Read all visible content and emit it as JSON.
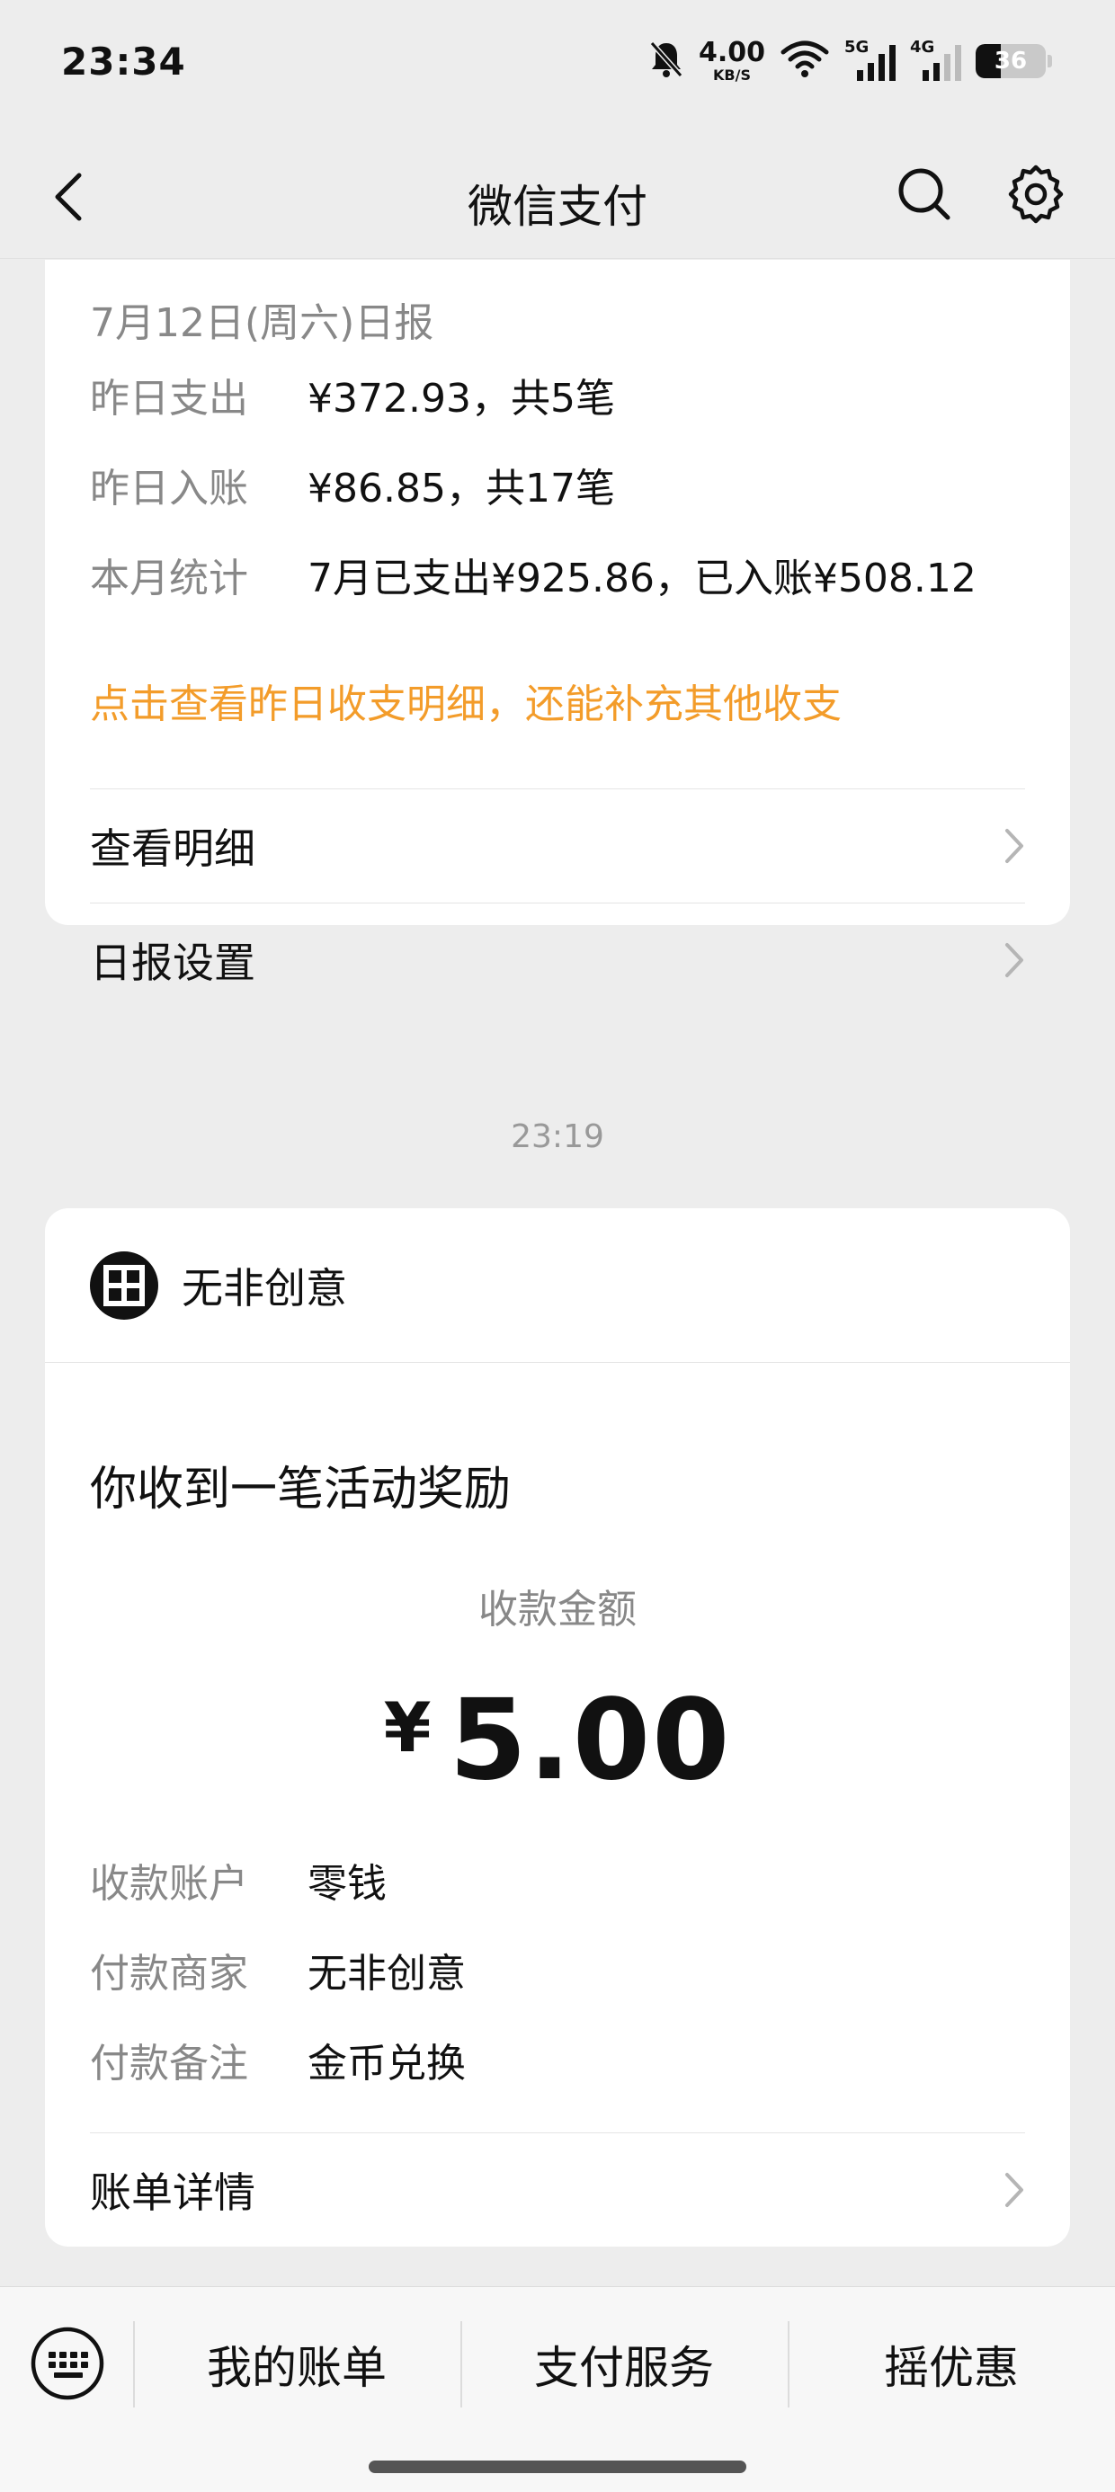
{
  "status_bar": {
    "time": "23:34",
    "net_speed": "4.00",
    "net_unit": "KB/S",
    "signal_1": "5G",
    "signal_2": "4G",
    "battery": "36",
    "battery_level": 0.36
  },
  "nav": {
    "title": "微信支付",
    "icons": [
      "back-icon",
      "search-icon",
      "settings-icon"
    ]
  },
  "daily_report": {
    "date": "7月12日(周六)日报",
    "rows": [
      {
        "label": "昨日支出",
        "value": "¥372.93，共5笔"
      },
      {
        "label": "昨日入账",
        "value": "¥86.85，共17笔"
      },
      {
        "label": "本月统计",
        "value": "7月已支出¥925.86，已入账¥508.12"
      }
    ],
    "link_text": "点击查看昨日收支明细，还能补充其他收支",
    "menu": [
      {
        "label": "查看明细"
      },
      {
        "label": "日报设置"
      }
    ]
  },
  "timestamp": "23:19",
  "reward": {
    "merchant": "无非创意",
    "title": "你收到一笔活动奖励",
    "amount_label": "收款金额",
    "currency": "¥",
    "amount": "5.00",
    "rows": [
      {
        "label": "收款账户",
        "value": "零钱"
      },
      {
        "label": "付款商家",
        "value": "无非创意"
      },
      {
        "label": "付款备注",
        "value": "金币兑换"
      }
    ],
    "menu_label": "账单详情"
  },
  "bottom_bar": {
    "tabs": [
      "我的账单",
      "支付服务",
      "摇优惠"
    ]
  },
  "colors": {
    "accent_orange": "#f39c2a",
    "background": "#ededed",
    "card": "#ffffff"
  }
}
